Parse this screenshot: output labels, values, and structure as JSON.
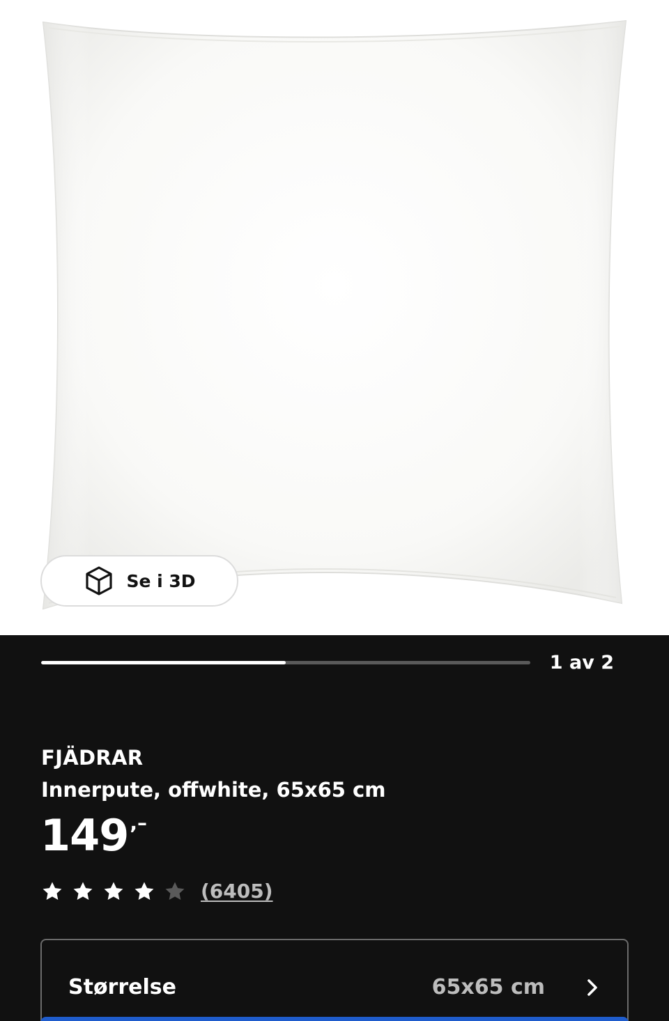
{
  "hero": {
    "image_alt": "FJÄDRAR Innerpute, offwhite, 65x65 cm",
    "view_3d_label": "Se i 3D",
    "view_3d_icon": "cube-icon"
  },
  "gallery": {
    "progress_fraction": 0.5,
    "counter_text": "1 av 2"
  },
  "product": {
    "brand": "FJÄDRAR",
    "description": "Innerpute, offwhite, 65x65 cm",
    "price_amount": "149",
    "price_suffix": ",–"
  },
  "rating": {
    "stars_value": 4,
    "stars_max": 5,
    "review_count_text": "(6405)",
    "star_fill_color": "#ffffff",
    "star_empty_color": "#5a5a5a"
  },
  "size_selector": {
    "label": "Størrelse",
    "value": "65x65 cm",
    "icon": "chevron-right-icon"
  },
  "colors": {
    "background": "#111111",
    "hero_background": "#ffffff",
    "accent_blue": "#1f5ccc"
  }
}
